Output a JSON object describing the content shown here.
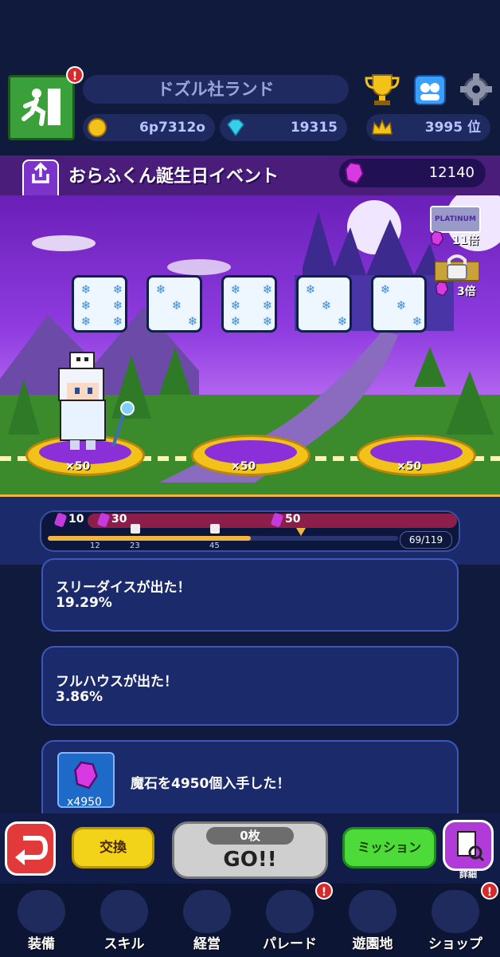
{
  "header": {
    "land_name": "ドズル社ランド",
    "coins": "6p7312o",
    "gems": "19315",
    "rank": "3995 位",
    "exit_badge": "!"
  },
  "event": {
    "share_label": "シェア",
    "title": "おらふくん誕生日イベント",
    "points": "12140",
    "platinum_badge": "PLATINUM",
    "platinum_multiplier": "11倍",
    "locked_multiplier": "3倍"
  },
  "dice": [
    6,
    3,
    6,
    3,
    3
  ],
  "board": {
    "pads": [
      "×50",
      "×50",
      "×50"
    ]
  },
  "progress": {
    "milestones": [
      "10",
      "30",
      "50"
    ],
    "ticks": [
      "12",
      "23",
      "45"
    ],
    "count": "69/119",
    "fraction": 0.58
  },
  "log": {
    "entries": [
      {
        "line1": "スリーダイスが出た！",
        "line2": "19.29%"
      },
      {
        "line1": "フルハウスが出た！",
        "line2": "3.86%"
      }
    ],
    "reward_text": "魔石を4950個入手した！",
    "reward_count": "x4950"
  },
  "controls": {
    "exchange": "交換",
    "tickets": "0枚",
    "go": "GO!!",
    "mission": "ミッション",
    "detail": "詳細"
  },
  "tabs": [
    {
      "label": "装備"
    },
    {
      "label": "スキル"
    },
    {
      "label": "経営"
    },
    {
      "label": "パレード"
    },
    {
      "label": "遊園地"
    },
    {
      "label": "ショップ"
    }
  ],
  "colors": {
    "accent_purple": "#8b2fd9",
    "gold": "#f2b640",
    "go_green": "#4ddb3a"
  }
}
